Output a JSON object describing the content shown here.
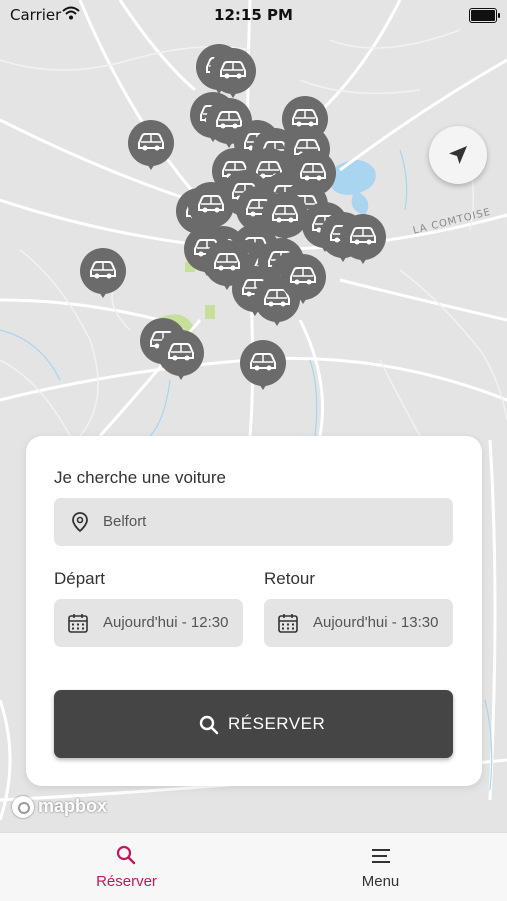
{
  "status_bar": {
    "carrier": "Carrier",
    "time": "12:15 PM"
  },
  "map": {
    "road_label": "LA COMTOISE",
    "attribution": "mapbox",
    "pin_icon": "car-icon",
    "locate_icon": "navigation-arrow-icon"
  },
  "search_card": {
    "title": "Je cherche une voiture",
    "location_value": "Belfort",
    "depart_label": "Départ",
    "retour_label": "Retour",
    "depart_value": "Aujourd'hui - 12:30",
    "retour_value": "Aujourd'hui - 13:30",
    "reserve_button": "RÉSERVER"
  },
  "tab_bar": {
    "tabs": [
      {
        "label": "Réserver",
        "icon": "search-icon",
        "active": true,
        "color": "#c2185b"
      },
      {
        "label": "Menu",
        "icon": "menu-icon",
        "active": false,
        "color": "#333333"
      }
    ]
  },
  "colors": {
    "accent": "#c2185b",
    "pin": "#6b6b6b",
    "button": "#454545"
  }
}
